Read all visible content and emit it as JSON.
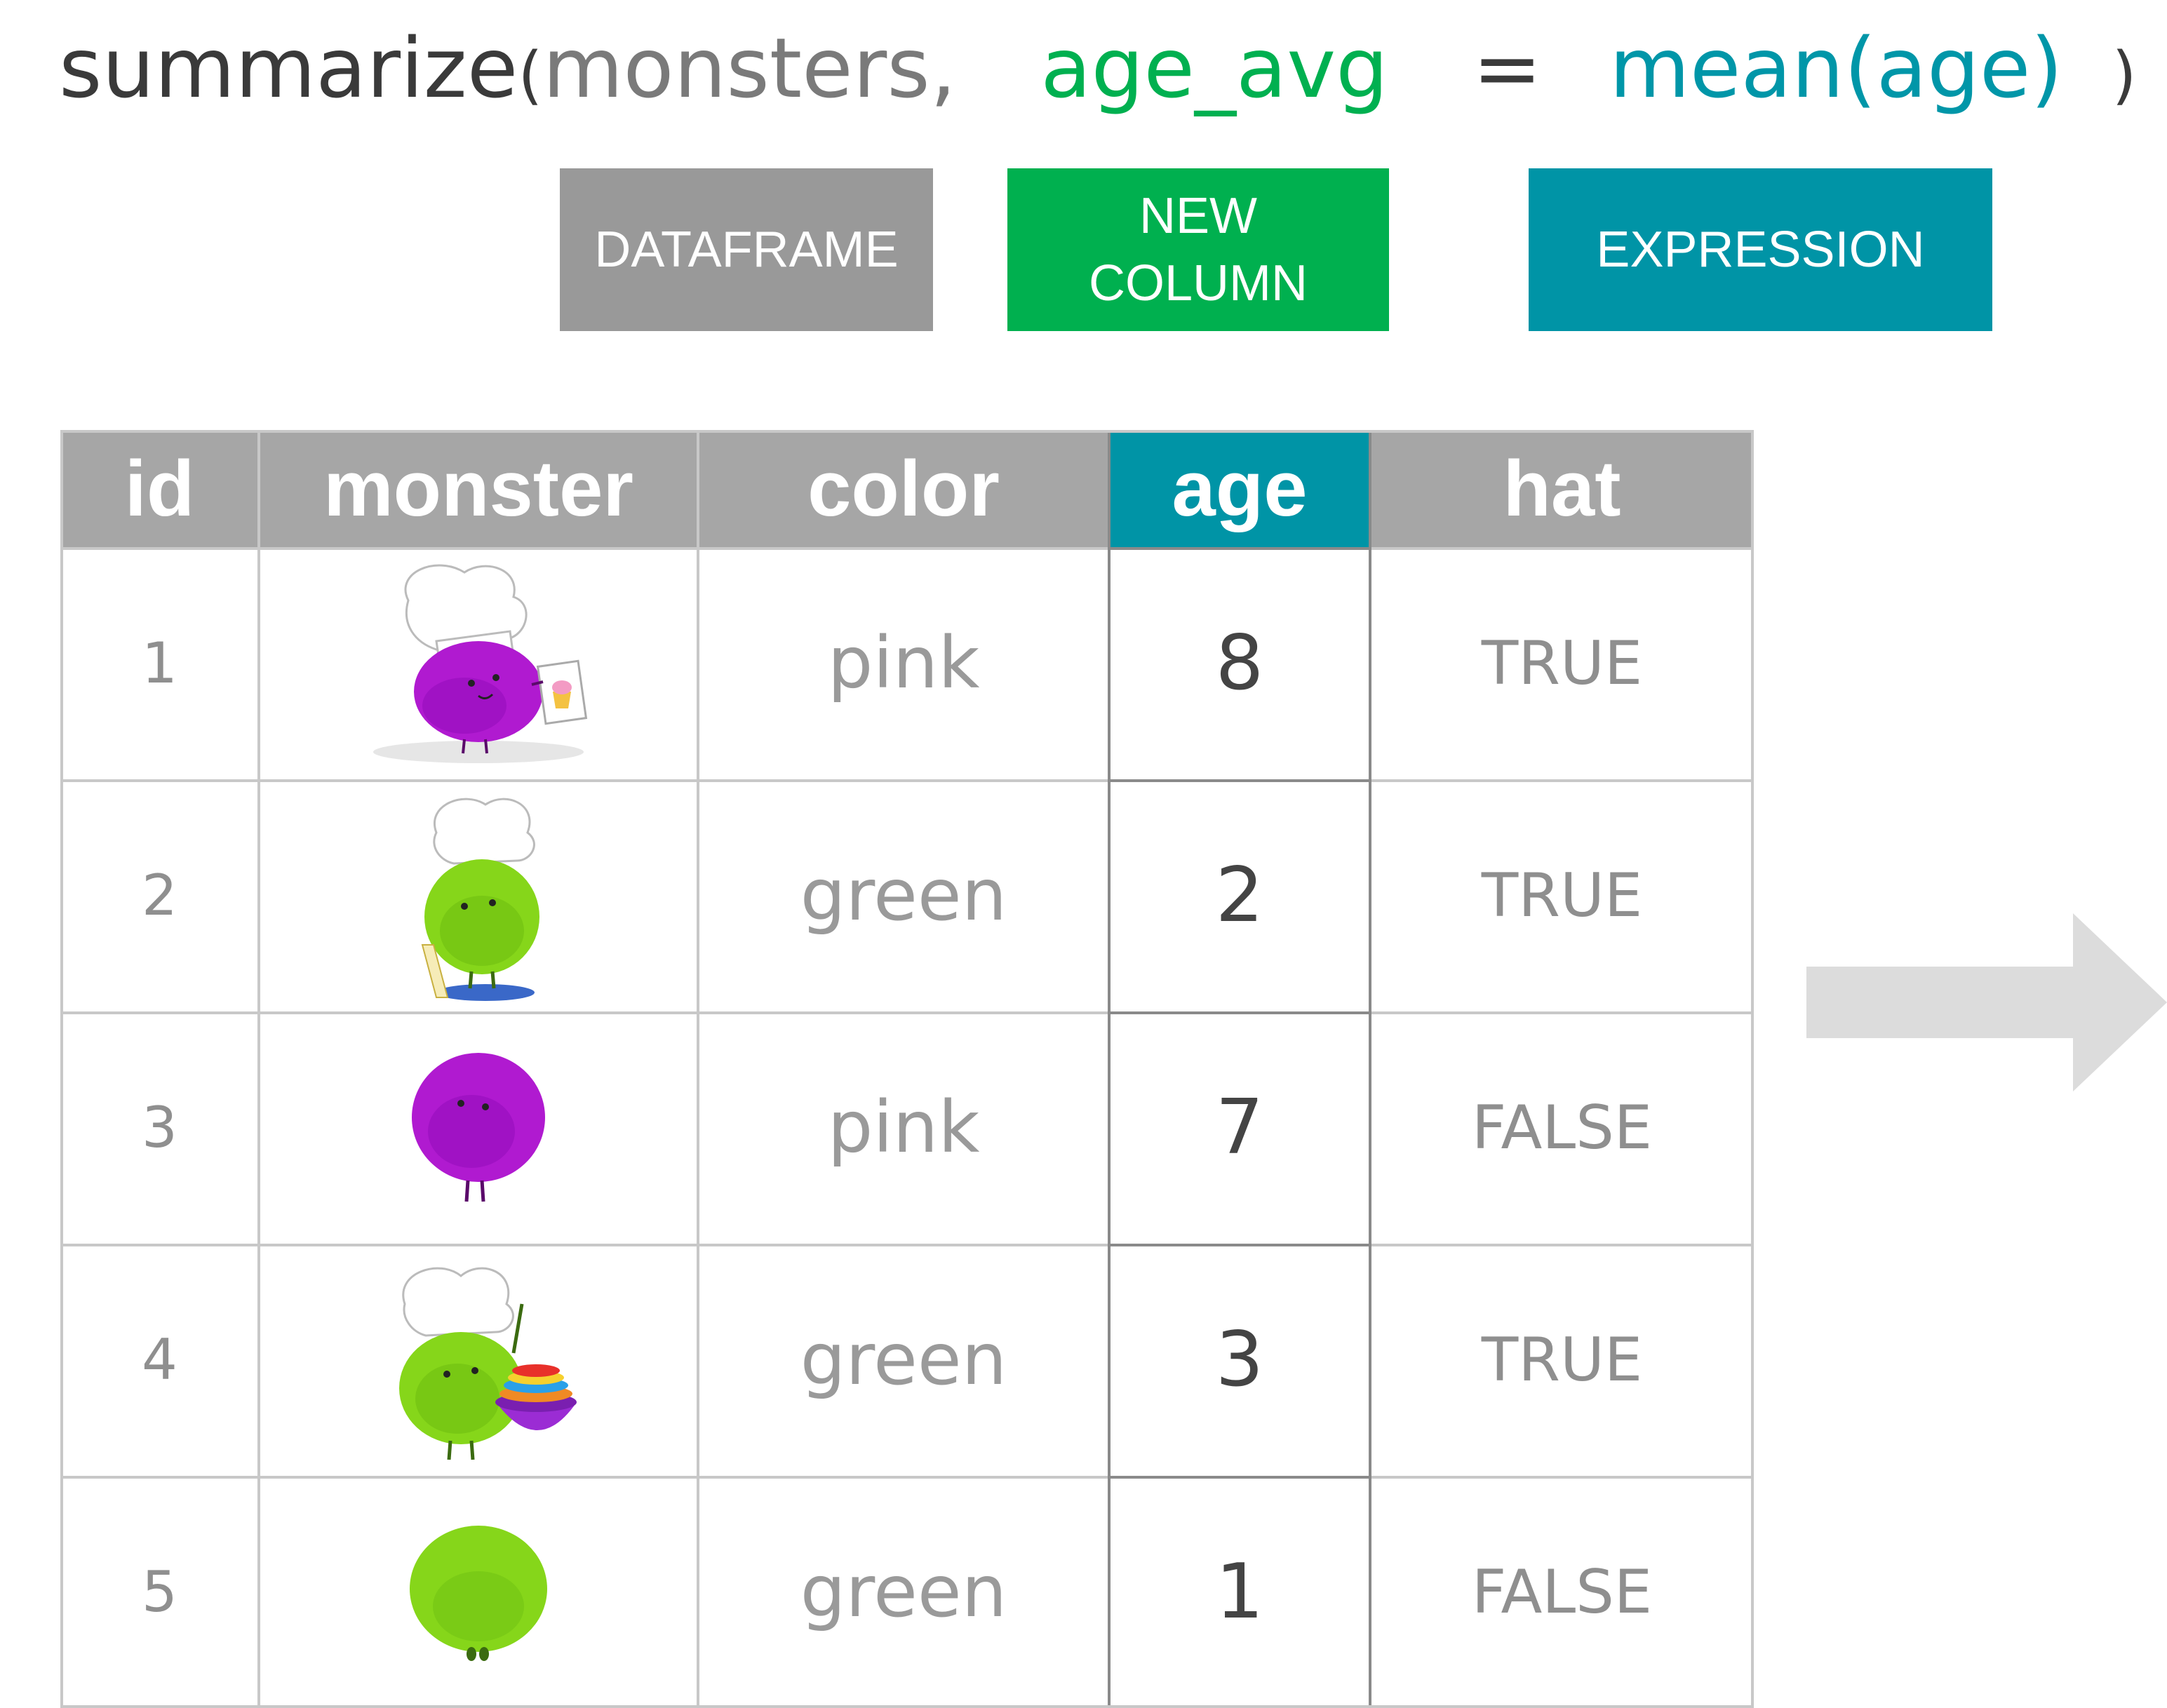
{
  "code": {
    "function": "summarize",
    "open_paren": "(",
    "dataframe_arg": "monsters,",
    "new_column": "age_avg",
    "equals": "=",
    "expression": "mean(age)",
    "close_paren": ")"
  },
  "labels": {
    "dataframe": "DATAFRAME",
    "new_column": "NEW\nCOLUMN",
    "expression": "EXPRESSION"
  },
  "table": {
    "headers": [
      "id",
      "monster",
      "color",
      "age",
      "hat"
    ],
    "highlighted_column": "age",
    "rows": [
      {
        "id": "1",
        "monster": "pink monster in chef hat holding cupcake sign",
        "color": "pink",
        "age": "8",
        "hat": "TRUE"
      },
      {
        "id": "2",
        "monster": "green monster in chef hat with whisk",
        "color": "green",
        "age": "2",
        "hat": "TRUE"
      },
      {
        "id": "3",
        "monster": "pink monster",
        "color": "pink",
        "age": "7",
        "hat": "FALSE"
      },
      {
        "id": "4",
        "monster": "green monster in chef hat holding bowls",
        "color": "green",
        "age": "3",
        "hat": "TRUE"
      },
      {
        "id": "5",
        "monster": "green monster",
        "color": "green",
        "age": "1",
        "hat": "FALSE"
      }
    ]
  },
  "colors": {
    "dataframe": "#999999",
    "new_column": "#00b04f",
    "expression": "#0094a6",
    "header": "#a6a6a6",
    "pink_monster": "#b01ad0",
    "green_monster": "#86d61a",
    "arrow": "#dcdcdc"
  },
  "icons": {
    "arrow": "right-arrow-icon"
  }
}
